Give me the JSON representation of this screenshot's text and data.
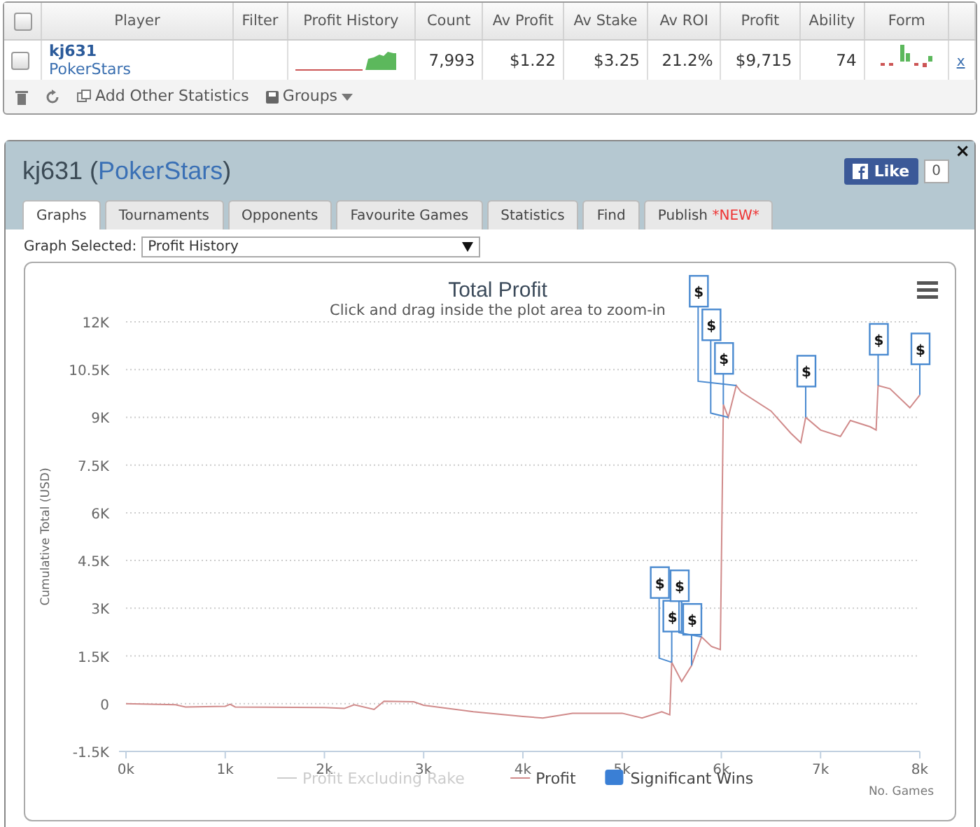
{
  "stats_table": {
    "select_all_checked": false,
    "columns": [
      "Player",
      "Filter",
      "Profit History",
      "Count",
      "Av Profit",
      "Av Stake",
      "Av ROI",
      "Profit",
      "Ability",
      "Form"
    ],
    "rows": [
      {
        "checked": false,
        "player": "kj631",
        "site": "PokerStars",
        "count": "7,993",
        "av_profit": "$1.22",
        "av_stake": "$3.25",
        "av_roi": "21.2%",
        "profit": "$9,715",
        "ability": "74",
        "remove": "x"
      }
    ],
    "toolbar": {
      "add_label": "Add Other Statistics",
      "groups_label": "Groups"
    }
  },
  "player_panel": {
    "title_name": "kj631",
    "title_open": "(",
    "title_site": "PokerStars",
    "title_close": ")",
    "like_label": "Like",
    "like_count": "0",
    "close": "×",
    "tabs": [
      {
        "label": "Graphs",
        "selected": true
      },
      {
        "label": "Tournaments",
        "selected": false
      },
      {
        "label": "Opponents",
        "selected": false
      },
      {
        "label": "Favourite Games",
        "selected": false
      },
      {
        "label": "Statistics",
        "selected": false
      },
      {
        "label": "Find",
        "selected": false
      },
      {
        "label": "Publish",
        "badge": "*NEW*",
        "selected": false
      }
    ],
    "graph_select": {
      "label": "Graph Selected:",
      "value": "Profit History"
    },
    "chart": {
      "subtitle": "Click and drag inside the plot area to zoom-in",
      "legend": [
        {
          "label": "Profit Excluding Rake",
          "kind": "line",
          "active": false
        },
        {
          "kind": "series",
          "active": true
        },
        {
          "label": "Significant Wins",
          "kind": "flag",
          "active": true
        }
      ],
      "chart_data": {
        "type": "line",
        "grid": true,
        "title": "Total Profit",
        "xlabel": "No. Games",
        "ylabel": "Cumulative Total (USD)",
        "xlim": [
          0,
          8000
        ],
        "ylim": [
          -1500,
          12000
        ],
        "xticks": [
          {
            "value": 0,
            "label": "0k"
          },
          {
            "value": 1000,
            "label": "1k"
          },
          {
            "value": 2000,
            "label": "2k"
          },
          {
            "value": 3000,
            "label": "3k"
          },
          {
            "value": 4000,
            "label": "4k"
          },
          {
            "value": 5000,
            "label": "5k"
          },
          {
            "value": 6000,
            "label": "6k"
          },
          {
            "value": 7000,
            "label": "7k"
          },
          {
            "value": 8000,
            "label": "8k"
          }
        ],
        "yticks": [
          {
            "value": -1500,
            "label": "-1.5K"
          },
          {
            "value": 0,
            "label": "0"
          },
          {
            "value": 1500,
            "label": "1.5K"
          },
          {
            "value": 3000,
            "label": "3K"
          },
          {
            "value": 4500,
            "label": "4.5K"
          },
          {
            "value": 6000,
            "label": "6K"
          },
          {
            "value": 7500,
            "label": "7.5K"
          },
          {
            "value": 9000,
            "label": "9K"
          },
          {
            "value": 10500,
            "label": "10.5K"
          },
          {
            "value": 12000,
            "label": "12K"
          }
        ],
        "x": [
          0,
          500,
          600,
          1000,
          1050,
          1100,
          2000,
          2200,
          2300,
          2500,
          2600,
          2900,
          3000,
          3500,
          4000,
          4200,
          4500,
          5000,
          5200,
          5400,
          5480,
          5500,
          5600,
          5700,
          5800,
          5900,
          5990,
          6020,
          6070,
          6150,
          6200,
          6500,
          6700,
          6800,
          6850,
          7000,
          7200,
          7300,
          7500,
          7560,
          7580,
          7700,
          7900,
          8000
        ],
        "series": [
          {
            "name": "Profit",
            "color": "#d08a8a",
            "values": [
              0,
              -30,
              -100,
              -80,
              -20,
              -100,
              -120,
              -150,
              -30,
              -180,
              80,
              60,
              -50,
              -250,
              -400,
              -450,
              -300,
              -300,
              -450,
              -250,
              -350,
              1300,
              700,
              1200,
              2100,
              1800,
              1700,
              9400,
              9000,
              10000,
              9800,
              9200,
              8500,
              8200,
              9000,
              8600,
              8400,
              8900,
              8700,
              8600,
              10000,
              9900,
              9300,
              9700
            ]
          }
        ],
        "annotations": [
          {
            "x": 5500,
            "y": 1300,
            "text": "$"
          },
          {
            "x": 5500,
            "y": 1300,
            "text": "$"
          },
          {
            "x": 5700,
            "y": 1200,
            "text": "$"
          },
          {
            "x": 5800,
            "y": 2100,
            "text": "$"
          },
          {
            "x": 6020,
            "y": 9400,
            "text": "$"
          },
          {
            "x": 6070,
            "y": 9000,
            "text": "$"
          },
          {
            "x": 6150,
            "y": 10000,
            "text": "$"
          },
          {
            "x": 6850,
            "y": 9000,
            "text": "$"
          },
          {
            "x": 7580,
            "y": 10000,
            "text": "$"
          },
          {
            "x": 8000,
            "y": 9700,
            "text": "$"
          }
        ]
      }
    }
  }
}
